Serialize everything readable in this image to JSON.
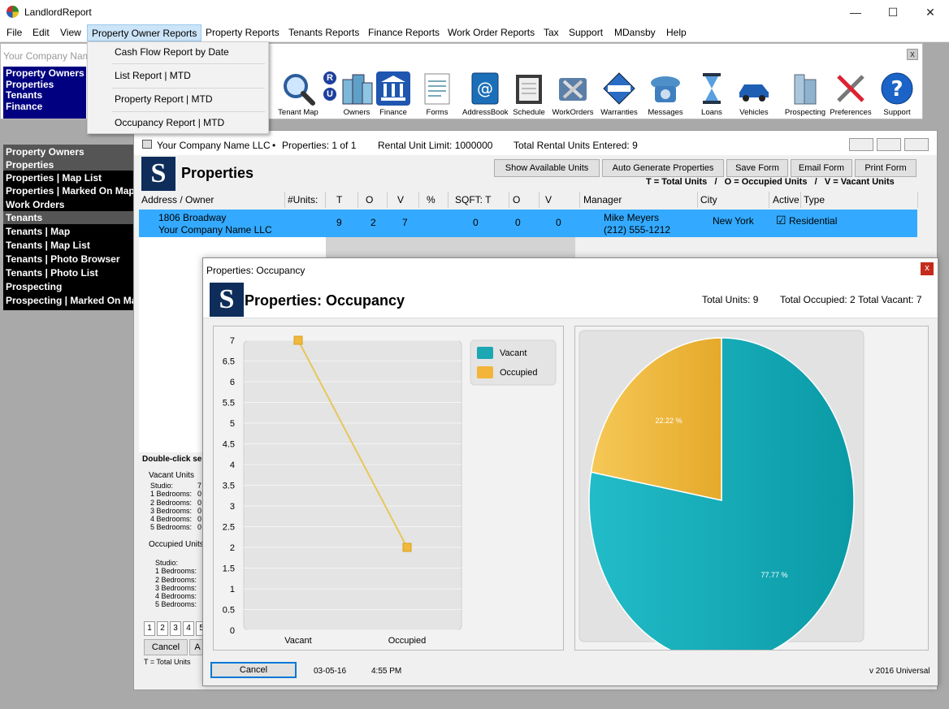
{
  "window": {
    "title": "LandlordReport"
  },
  "menu": [
    "File",
    "Edit",
    "View",
    "Property Owner Reports",
    "Property Reports",
    "Tenants Reports",
    "Finance Reports",
    "Work Order Reports",
    "Tax",
    "Support",
    "MDansby",
    "Help"
  ],
  "dropdown": [
    "Cash Flow Report by Date",
    "List Report | MTD",
    "Property Report | MTD",
    "Occupancy Report | MTD"
  ],
  "toolbar": {
    "company_placeholder": "Your Company Name",
    "ru_label_r": "R",
    "ru_label_u": "U",
    "items": [
      "Tenant Map",
      "Owners",
      "Finance",
      "Forms",
      "AddressBook",
      "Schedule",
      "WorkOrders",
      "Warranties",
      "Messages",
      "Loans",
      "Vehicles",
      "Prospecting",
      "Preferences",
      "Support"
    ],
    "close": "x"
  },
  "leftnav_top": [
    "Property Owners",
    "Properties",
    "Tenants",
    "Finance"
  ],
  "leftnav": [
    {
      "label": "Property Owners",
      "header": true
    },
    {
      "label": "Properties",
      "header": true
    },
    {
      "label": "Properties | Map List"
    },
    {
      "label": "Properties | Marked On Map"
    },
    {
      "label": "Work Orders"
    },
    {
      "label": "Tenants",
      "header": true
    },
    {
      "label": "Tenants | Map"
    },
    {
      "label": "Tenants | Map List"
    },
    {
      "label": "Tenants | Photo Browser"
    },
    {
      "label": "Tenants | Photo List"
    },
    {
      "label": "Prospecting"
    },
    {
      "label": "Prospecting | Marked On Map"
    }
  ],
  "properties_window": {
    "company": "Your Company Name LLC",
    "bullet": "•",
    "properties_count": "Properties: 1 of 1",
    "rental_limit": "Rental Unit Limit: 1000000",
    "total_entered": "Total Rental Units Entered: 9",
    "title": "Properties",
    "logo": "S",
    "buttons": [
      "Show Available Units",
      "Auto Generate Properties",
      "Save Form",
      "Email Form",
      "Print Form"
    ],
    "legend": "T = Total Units   /   O = Occupied Units   /   V = Vacant Units",
    "columns": [
      "Address / Owner",
      "#Units:",
      "T",
      "O",
      "V",
      "%",
      "SQFT:  T",
      "O",
      "V",
      "Manager",
      "City",
      "Active",
      "Type"
    ],
    "row": {
      "address": "1806 Broadway",
      "owner": "Your Company Name LLC",
      "t": "9",
      "o": "2",
      "v": "7",
      "pct": "",
      "sqft_t": "0",
      "sqft_o": "0",
      "sqft_v": "0",
      "manager": "Mike Meyers",
      "phone": "(212) 555-1212",
      "city": "New York",
      "active": "☑",
      "type": "Residential"
    },
    "double_click": "Double-click sele",
    "vacant_group": "Vacant Units",
    "occupied_group": "Occupied Units",
    "unit_rows": [
      "Studio:",
      "1 Bedrooms:",
      "2 Bedrooms:",
      "3 Bedrooms:",
      "4 Bedrooms:",
      "5 Bedrooms:"
    ],
    "vacant_values": [
      "7",
      "0",
      "0",
      "0",
      "0",
      "0"
    ],
    "pages": [
      "1",
      "2",
      "3",
      "4",
      "5"
    ],
    "cancel": "Cancel",
    "cancel2": "A",
    "footer": "T = Total Units"
  },
  "occupancy": {
    "window_title": "Properties:  Occupancy",
    "logo": "S",
    "title": "Properties:  Occupancy",
    "total_units": "Total Units:  9",
    "total_occupied": "Total Occupied: 2",
    "total_vacant": "Total Vacant: 7",
    "close": "x",
    "cancel": "Cancel",
    "date": "03-05-16",
    "time": "4:55 PM",
    "version": "v 2016 Universal"
  },
  "colors": {
    "vacant": "#1ba7b4",
    "occupied": "#f2b53a",
    "nav": "#000080",
    "selection": "#33aaff"
  },
  "chart_data": [
    {
      "type": "line",
      "categories": [
        "Vacant",
        "Occupied"
      ],
      "series": [
        {
          "values": [
            7,
            2
          ]
        }
      ],
      "ylim": [
        0,
        7
      ],
      "yticks": [
        "0",
        "0.5",
        "1",
        "1.5",
        "2",
        "2.5",
        "3",
        "3.5",
        "4",
        "4.5",
        "5",
        "5.5",
        "6",
        "6.5",
        "7"
      ],
      "legend": [
        "Vacant",
        "Occupied"
      ],
      "legend_position": "top-right"
    },
    {
      "type": "pie",
      "slices": [
        {
          "label": "Vacant",
          "value": 77.77,
          "text": "77.77 %"
        },
        {
          "label": "Occupied",
          "value": 22.22,
          "text": "22.22 %"
        }
      ]
    }
  ]
}
